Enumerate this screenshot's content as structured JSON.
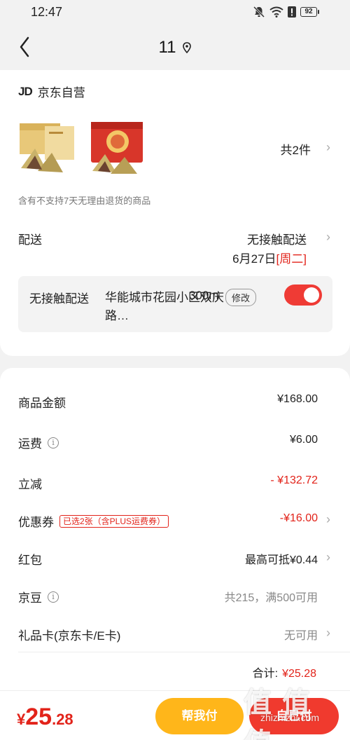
{
  "status_bar": {
    "time": "12:47",
    "battery": "92"
  },
  "nav": {
    "title": "11"
  },
  "shop": {
    "logo": "JD",
    "name": "京东自营"
  },
  "goods": {
    "count_label": "共2件"
  },
  "notice": "含有不支持7天无理由退货的商品",
  "delivery": {
    "label": "配送",
    "method": "无接触配送",
    "date": "6月27日",
    "weekday": "[周二]"
  },
  "contactless": {
    "title": "无接触配送",
    "address": "华能城市花园小区双庆路…",
    "distance": "300m",
    "edit_label": "修改",
    "enabled": true
  },
  "summary": {
    "rows": [
      {
        "label": "商品金额",
        "value": "¥168.00"
      },
      {
        "label": "运费",
        "value": "¥6.00"
      },
      {
        "label": "立减",
        "value": "- ¥132.72"
      },
      {
        "label": "优惠券",
        "tag": "已选2张（含PLUS运费券）",
        "value": "-¥16.00"
      },
      {
        "label": "红包",
        "value": "最高可抵¥0.44"
      },
      {
        "label": "京豆",
        "value": "共215，满500可用"
      },
      {
        "label": "礼品卡(京东卡/E卡)",
        "value": "无可用"
      }
    ],
    "total_label": "合计:",
    "total_amount": "¥25.28"
  },
  "bottom": {
    "currency": "¥",
    "amount_int": "25",
    "amount_dec": ".28",
    "help_pay_label": "帮我付",
    "self_pay_label": "自己付"
  },
  "watermark": {
    "glyphs": "值 值 值",
    "text": "zhizhizhi.com"
  },
  "colors": {
    "accent_red": "#e2231a",
    "help_button": "#ffb61a",
    "pay_button": "#f03a2e"
  }
}
